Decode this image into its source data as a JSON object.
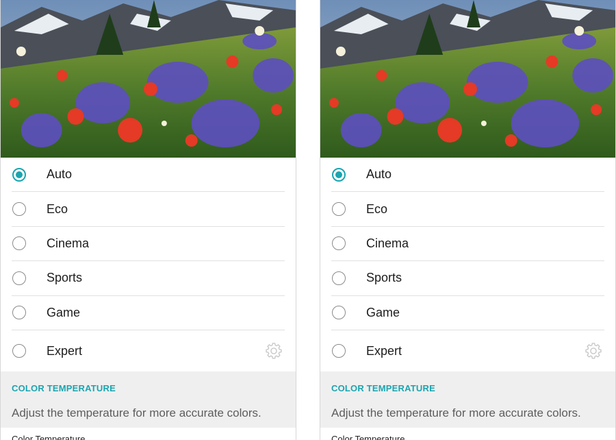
{
  "screens": [
    {
      "modes": [
        {
          "label": "Auto",
          "selected": true
        },
        {
          "label": "Eco",
          "selected": false
        },
        {
          "label": "Cinema",
          "selected": false
        },
        {
          "label": "Sports",
          "selected": false
        },
        {
          "label": "Game",
          "selected": false
        },
        {
          "label": "Expert",
          "selected": false,
          "icon": "gear-icon"
        }
      ],
      "section": {
        "title": "COLOR TEMPERATURE",
        "description": "Adjust the temperature for more accurate colors.",
        "next_item_label": "Color Temperature"
      }
    },
    {
      "modes": [
        {
          "label": "Auto",
          "selected": true
        },
        {
          "label": "Eco",
          "selected": false
        },
        {
          "label": "Cinema",
          "selected": false
        },
        {
          "label": "Sports",
          "selected": false
        },
        {
          "label": "Game",
          "selected": false
        },
        {
          "label": "Expert",
          "selected": false,
          "icon": "gear-icon"
        }
      ],
      "section": {
        "title": "COLOR TEMPERATURE",
        "description": "Adjust the temperature for more accurate colors.",
        "next_item_label": "Color Temperature"
      }
    }
  ],
  "colors": {
    "accent": "#1aa5b0",
    "divider": "#e0e0e0",
    "section_bg": "#efefef"
  }
}
